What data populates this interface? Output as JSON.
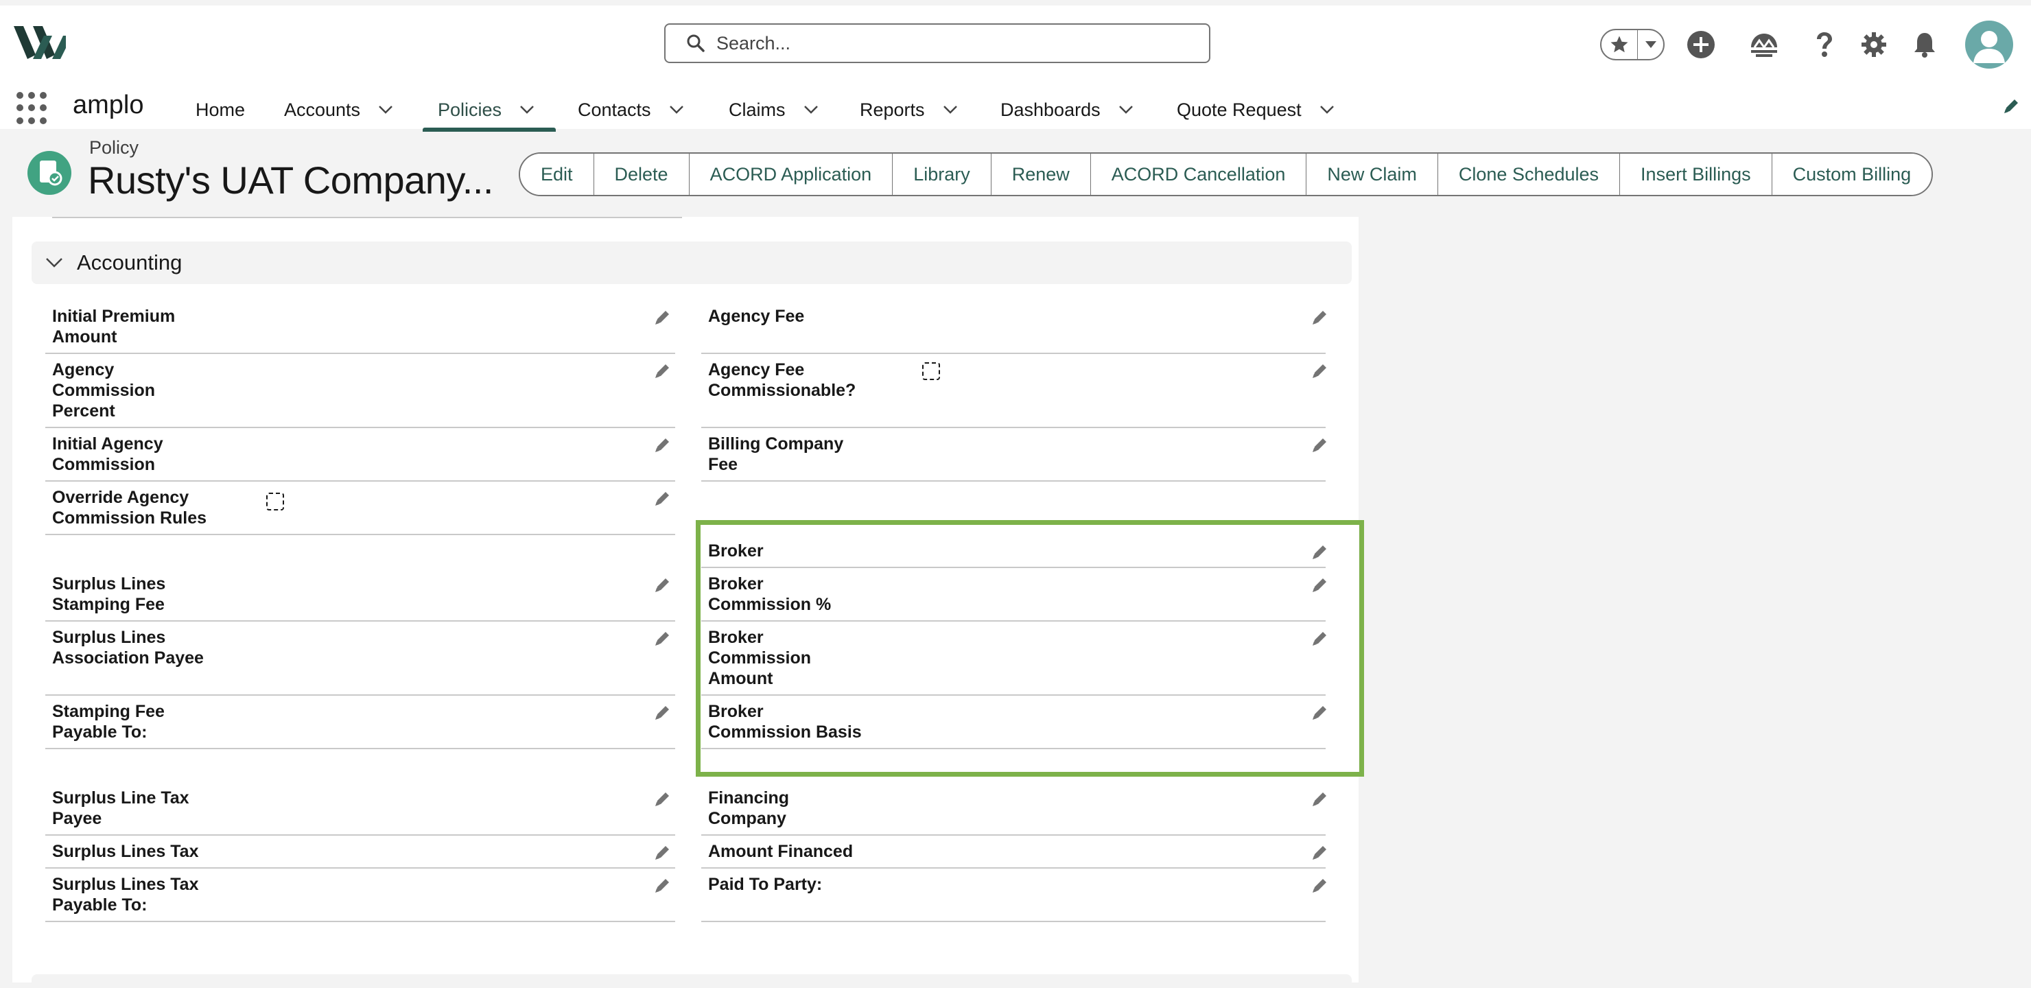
{
  "header": {
    "search_placeholder": "Search...",
    "icons": [
      "logo-mark",
      "search-icon",
      "favorites-star-icon",
      "chevron-down-icon",
      "add-icon",
      "trailhead-icon",
      "help-icon",
      "setup-gear-icon",
      "notifications-bell-icon",
      "user-avatar"
    ]
  },
  "nav": {
    "app_name": "amplo",
    "items": [
      {
        "label": "Home",
        "has_menu": false,
        "active": false
      },
      {
        "label": "Accounts",
        "has_menu": true,
        "active": false
      },
      {
        "label": "Policies",
        "has_menu": true,
        "active": true
      },
      {
        "label": "Contacts",
        "has_menu": true,
        "active": false
      },
      {
        "label": "Claims",
        "has_menu": true,
        "active": false
      },
      {
        "label": "Reports",
        "has_menu": true,
        "active": false
      },
      {
        "label": "Dashboards",
        "has_menu": true,
        "active": false
      },
      {
        "label": "Quote Request",
        "has_menu": true,
        "active": false
      }
    ]
  },
  "record": {
    "type": "Policy",
    "title": "Rusty's UAT Company...",
    "actions": [
      "Edit",
      "Delete",
      "ACORD Application",
      "Library",
      "Renew",
      "ACORD Cancellation",
      "New Claim",
      "Clone Schedules",
      "Insert Billings",
      "Custom Billing"
    ]
  },
  "section": {
    "title": "Accounting"
  },
  "fields": {
    "initial_premium_amount": "Initial Premium\nAmount",
    "agency_fee": "Agency Fee",
    "agency_commission_percent": "Agency\nCommission\nPercent",
    "agency_fee_commissionable": "Agency Fee\nCommissionable?",
    "initial_agency_commission": "Initial Agency\nCommission",
    "billing_company_fee": "Billing Company\nFee",
    "override_agency_commission_rules": "Override Agency\nCommission Rules",
    "broker": "Broker",
    "surplus_lines_stamping_fee": "Surplus Lines\nStamping Fee",
    "broker_commission_pct": "Broker\nCommission %",
    "surplus_lines_association_payee": "Surplus Lines\nAssociation Payee",
    "broker_commission_amount": "Broker\nCommission\nAmount",
    "stamping_fee_payable_to": "Stamping Fee\nPayable To:",
    "broker_commission_basis": "Broker\nCommission Basis",
    "surplus_line_tax_payee": "Surplus Line Tax\nPayee",
    "financing_company": "Financing\nCompany",
    "surplus_lines_tax": "Surplus Lines Tax",
    "amount_financed": "Amount Financed",
    "surplus_lines_tax_payable_to": "Surplus Lines Tax\nPayable To:",
    "paid_to_party": "Paid To Party:"
  },
  "colors": {
    "brand": "#2b5c53",
    "highlight": "#7db24a",
    "avatar": "#6aa9a8",
    "record_icon": "#41a382"
  }
}
